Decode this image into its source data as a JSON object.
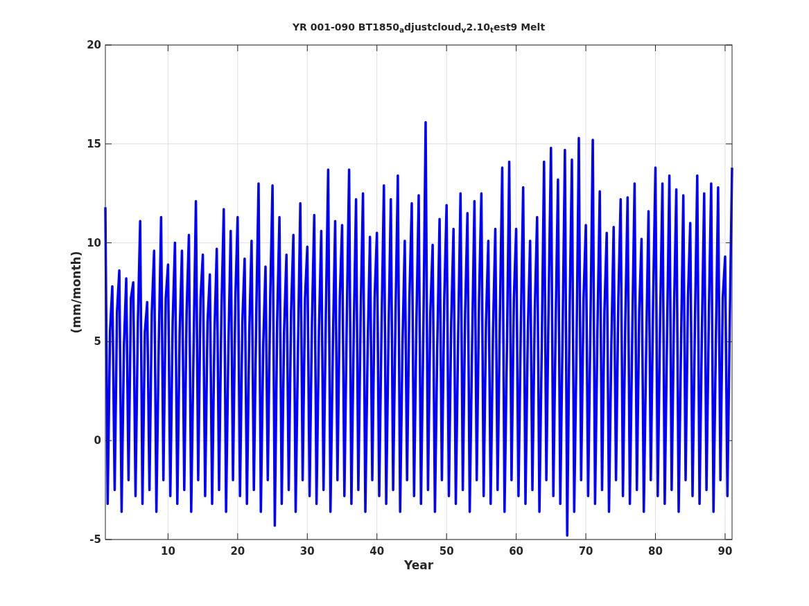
{
  "figure": {
    "chart_data": {
      "type": "line",
      "title": "YR 001-090 BT1850$_{a}$djustcloud$_{v}$2.10$_{t}$est9 Melt",
      "xlabel": "Year",
      "ylabel": "(mm/month)",
      "xlim": [
        1,
        91
      ],
      "ylim": [
        -5,
        20
      ],
      "xticks": [
        10,
        20,
        30,
        40,
        50,
        60,
        70,
        80,
        90
      ],
      "yticks": [
        -5,
        0,
        5,
        10,
        15,
        20
      ],
      "x": [
        1,
        1.33,
        1.67,
        2,
        2.33,
        2.67,
        3,
        3.33,
        3.67,
        4,
        4.33,
        4.67,
        5,
        5.33,
        5.67,
        6,
        6.33,
        6.67,
        7,
        7.33,
        7.67,
        8,
        8.33,
        8.67,
        9,
        9.33,
        9.67,
        10,
        10.33,
        10.67,
        11,
        11.33,
        11.67,
        12,
        12.33,
        12.67,
        13,
        13.33,
        13.67,
        14,
        14.33,
        14.67,
        15,
        15.33,
        15.67,
        16,
        16.33,
        16.67,
        17,
        17.33,
        17.67,
        18,
        18.33,
        18.67,
        19,
        19.33,
        19.67,
        20,
        20.33,
        20.67,
        21,
        21.33,
        21.67,
        22,
        22.33,
        22.67,
        23,
        23.33,
        23.67,
        24,
        24.33,
        24.67,
        25,
        25.33,
        25.67,
        26,
        26.33,
        26.67,
        27,
        27.33,
        27.67,
        28,
        28.33,
        28.67,
        29,
        29.33,
        29.67,
        30,
        30.33,
        30.67,
        31,
        31.33,
        31.67,
        32,
        32.33,
        32.67,
        33,
        33.33,
        33.67,
        34,
        34.33,
        34.67,
        35,
        35.33,
        35.67,
        36,
        36.33,
        36.67,
        37,
        37.33,
        37.67,
        38,
        38.33,
        38.67,
        39,
        39.33,
        39.67,
        40,
        40.33,
        40.67,
        41,
        41.33,
        41.67,
        42,
        42.33,
        42.67,
        43,
        43.33,
        43.67,
        44,
        44.33,
        44.67,
        45,
        45.33,
        45.67,
        46,
        46.33,
        46.67,
        47,
        47.33,
        47.67,
        48,
        48.33,
        48.67,
        49,
        49.33,
        49.67,
        50,
        50.33,
        50.67,
        51,
        51.33,
        51.67,
        52,
        52.33,
        52.67,
        53,
        53.33,
        53.67,
        54,
        54.33,
        54.67,
        55,
        55.33,
        55.67,
        56,
        56.33,
        56.67,
        57,
        57.33,
        57.67,
        58,
        58.33,
        58.67,
        59,
        59.33,
        59.67,
        60,
        60.33,
        60.67,
        61,
        61.33,
        61.67,
        62,
        62.33,
        62.67,
        63,
        63.33,
        63.67,
        64,
        64.33,
        64.67,
        65,
        65.33,
        65.67,
        66,
        66.33,
        66.67,
        67,
        67.33,
        67.67,
        68,
        68.33,
        68.67,
        69,
        69.33,
        69.67,
        70,
        70.33,
        70.67,
        71,
        71.33,
        71.67,
        72,
        72.33,
        72.67,
        73,
        73.33,
        73.67,
        74,
        74.33,
        74.67,
        75,
        75.33,
        75.67,
        76,
        76.33,
        76.67,
        77,
        77.33,
        77.67,
        78,
        78.33,
        78.67,
        79,
        79.33,
        79.67,
        80,
        80.33,
        80.67,
        81,
        81.33,
        81.67,
        82,
        82.33,
        82.67,
        83,
        83.33,
        83.67,
        84,
        84.33,
        84.67,
        85,
        85.33,
        85.67,
        86,
        86.33,
        86.67,
        87,
        87.33,
        87.67,
        88,
        88.33,
        88.67,
        89,
        89.33,
        89.67,
        90,
        90.33,
        90.67,
        91
      ],
      "grid": true,
      "series": [
        {
          "color": "#0000ff",
          "values": [
            11.8,
            -3.2,
            5.5,
            7.8,
            -2.5,
            6.5,
            8.6,
            -3.6,
            4.8,
            8.2,
            -2.0,
            7.2,
            8.0,
            -2.8,
            6.0,
            11.1,
            -3.2,
            5.5,
            7.0,
            -2.5,
            6.5,
            9.6,
            -3.6,
            4.8,
            11.3,
            -2.0,
            7.2,
            8.9,
            -2.8,
            6.0,
            10.0,
            -3.2,
            5.5,
            9.6,
            -2.5,
            6.5,
            10.4,
            -3.6,
            4.8,
            12.1,
            -2.0,
            7.2,
            9.4,
            -2.8,
            6.0,
            8.4,
            -3.2,
            5.5,
            9.7,
            -2.5,
            6.5,
            11.7,
            -3.6,
            4.8,
            10.6,
            -2.0,
            7.2,
            11.3,
            -2.8,
            6.0,
            9.2,
            -3.2,
            5.5,
            10.1,
            -2.5,
            6.5,
            13.0,
            -3.6,
            4.8,
            8.8,
            -2.0,
            7.2,
            12.9,
            -4.3,
            6.0,
            11.3,
            -3.2,
            5.5,
            9.4,
            -2.5,
            6.5,
            10.4,
            -3.6,
            4.8,
            12.0,
            -2.0,
            7.2,
            9.8,
            -2.8,
            6.0,
            11.4,
            -3.2,
            5.5,
            10.6,
            -2.5,
            6.5,
            13.7,
            -3.6,
            4.8,
            11.1,
            -2.0,
            7.2,
            10.9,
            -2.8,
            6.0,
            13.7,
            -3.2,
            5.5,
            12.2,
            -2.5,
            6.5,
            12.5,
            -3.6,
            4.8,
            10.3,
            -2.0,
            7.2,
            10.5,
            -2.8,
            6.0,
            12.9,
            -3.2,
            5.5,
            12.2,
            -2.5,
            6.5,
            13.4,
            -3.6,
            4.8,
            10.1,
            -2.0,
            7.2,
            12.0,
            -2.8,
            6.0,
            12.4,
            -3.2,
            5.5,
            16.1,
            -2.5,
            6.5,
            9.9,
            -3.6,
            4.8,
            11.2,
            -2.0,
            7.2,
            11.9,
            -2.8,
            6.0,
            10.7,
            -3.2,
            5.5,
            12.5,
            -2.5,
            6.5,
            11.5,
            -3.6,
            4.8,
            12.1,
            -2.0,
            7.2,
            12.5,
            -2.8,
            6.0,
            10.1,
            -3.2,
            5.5,
            10.7,
            -2.5,
            6.5,
            13.8,
            -3.6,
            4.8,
            14.1,
            -2.0,
            7.2,
            10.7,
            -2.8,
            6.0,
            12.8,
            -3.2,
            5.5,
            10.1,
            -2.5,
            6.5,
            11.3,
            -3.6,
            4.8,
            14.1,
            -2.0,
            7.2,
            14.8,
            -2.8,
            6.0,
            13.2,
            -3.2,
            5.5,
            14.7,
            -4.8,
            6.5,
            14.2,
            -3.6,
            4.8,
            15.3,
            -2.0,
            7.2,
            10.9,
            -2.8,
            6.0,
            15.2,
            -3.2,
            5.5,
            12.6,
            -2.5,
            6.5,
            10.5,
            -3.6,
            4.8,
            10.8,
            -2.0,
            7.2,
            12.2,
            -2.8,
            6.0,
            12.3,
            -3.2,
            5.5,
            13.0,
            -2.5,
            6.5,
            10.2,
            -3.6,
            4.8,
            11.6,
            -2.0,
            7.2,
            13.8,
            -2.8,
            6.0,
            13.0,
            -3.2,
            5.5,
            13.4,
            -2.5,
            6.5,
            12.7,
            -3.6,
            4.8,
            12.4,
            -2.0,
            7.2,
            11.0,
            -2.8,
            6.0,
            13.4,
            -3.2,
            5.5,
            12.5,
            -2.5,
            6.5,
            13.0,
            -3.6,
            4.8,
            12.8,
            -2.0,
            7.2,
            9.3,
            -2.8,
            6.0,
            13.8
          ]
        }
      ]
    }
  }
}
